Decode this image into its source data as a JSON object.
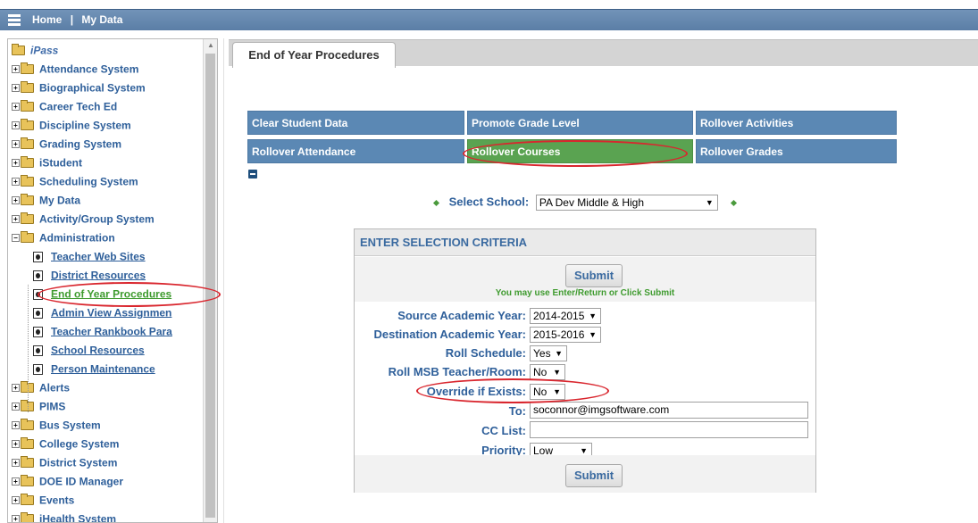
{
  "topbar": {
    "home": "Home",
    "separator": "|",
    "my_data": "My Data"
  },
  "sidebar": {
    "root": "iPass",
    "items_top": [
      "Attendance System",
      "Biographical System",
      "Career Tech Ed",
      "Discipline System",
      "Grading System",
      "iStudent",
      "Scheduling System",
      "My Data",
      "Activity/Group System",
      "Administration"
    ],
    "admin_children": [
      "Teacher Web Sites",
      "District Resources",
      "End of Year Procedures",
      "Admin View Assignmen",
      "Teacher Rankbook Para",
      "School Resources",
      "Person Maintenance"
    ],
    "items_bottom": [
      "Alerts",
      "PIMS",
      "Bus System",
      "College System",
      "District System",
      "DOE ID Manager",
      "Events",
      "iHealth System"
    ]
  },
  "tab": {
    "label": "End of Year Procedures"
  },
  "procedures": {
    "row1": [
      "Clear Student Data",
      "Promote Grade Level",
      "Rollover Activities"
    ],
    "row2": [
      "Rollover Attendance",
      "Rollover Courses",
      "Rollover Grades"
    ],
    "active": "Rollover Courses"
  },
  "school": {
    "label": "Select School:",
    "value": "PA Dev Middle & High"
  },
  "criteria": {
    "header": "ENTER SELECTION CRITERIA",
    "submit": "Submit",
    "hint": "You may use Enter/Return or Click Submit",
    "fields": {
      "source_year": {
        "label": "Source Academic Year:",
        "value": "2014-2015"
      },
      "dest_year": {
        "label": "Destination Academic Year:",
        "value": "2015-2016"
      },
      "roll_schedule": {
        "label": "Roll Schedule:",
        "value": "Yes"
      },
      "roll_msb": {
        "label": "Roll MSB Teacher/Room:",
        "value": "No"
      },
      "override": {
        "label": "Override if Exists:",
        "value": "No"
      },
      "to": {
        "label": "To:",
        "value": "soconnor@imgsoftware.com"
      },
      "cc": {
        "label": "CC List:",
        "value": ""
      },
      "priority": {
        "label": "Priority:",
        "value": "Low"
      }
    }
  },
  "colors": {
    "tree_link": "#2e5f9a",
    "active_green": "#5aa351",
    "button_blue": "#5b88b4",
    "highlight_red": "#d9262e"
  }
}
